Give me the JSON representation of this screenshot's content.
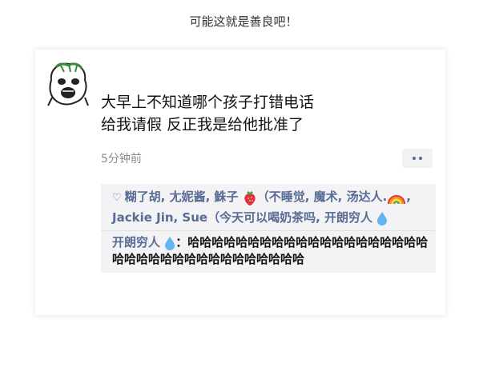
{
  "caption": "可能这就是善良吧！",
  "post": {
    "lines": [
      "大早上不知道哪个孩子打错电话",
      "给我请假 反正我是给他批准了"
    ],
    "time": "5分钟前"
  },
  "likes": {
    "names_part1": "糊了胡, 尢妮酱, 鮢子",
    "names_part2": "（不睡觉, 魔术, 汤达人.",
    "names_part3": ", Jackie Jin, Sue（今天可以喝奶茶吗, 开朗穷人",
    "icons": [
      "heart-outline-icon",
      "strawberry-icon",
      "rainbow-icon",
      "water-drop-icon"
    ]
  },
  "comment": {
    "author": "开朗穷人",
    "separator": "：",
    "text": "哈哈哈哈哈哈哈哈哈哈哈哈哈哈哈哈哈哈哈哈哈哈哈哈哈哈哈哈哈哈哈哈哈哈哈哈"
  },
  "colors": {
    "link": "#576b95",
    "text": "#111111",
    "muted": "#8a8a8a",
    "panel": "#f3f3f5"
  }
}
